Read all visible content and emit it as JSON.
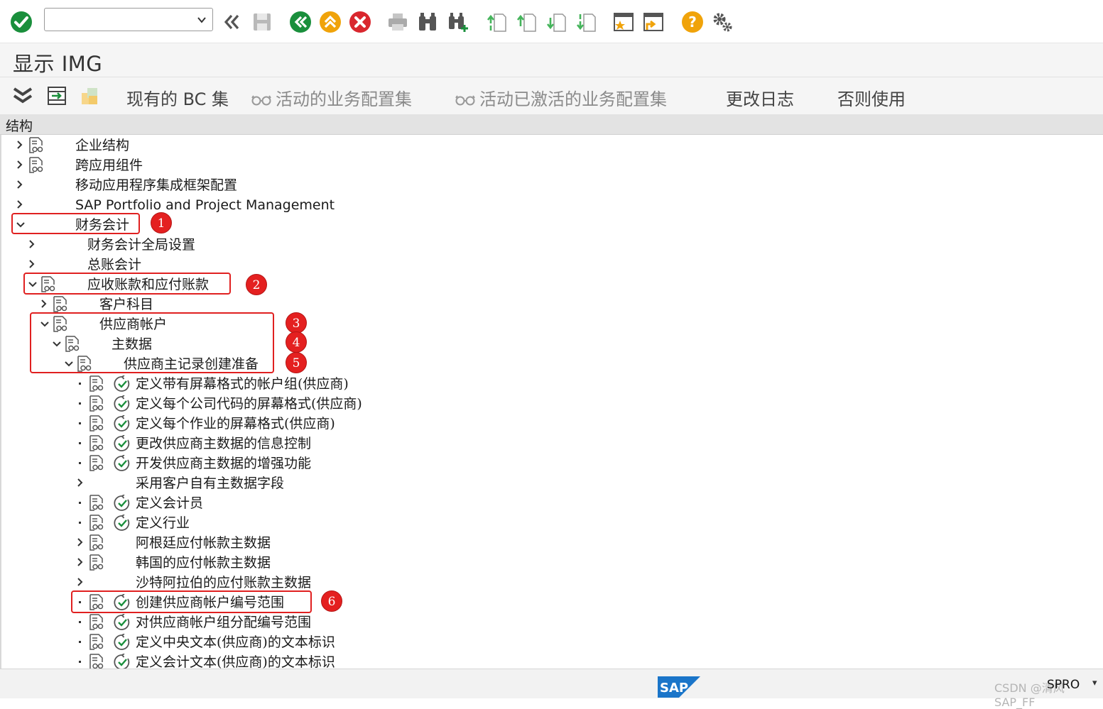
{
  "toolbar": {
    "command_value": "",
    "command_placeholder": ""
  },
  "title": "显示 IMG",
  "app_toolbar": {
    "bc_sets": "现有的 BC 集",
    "active_bc_sets": "活动的业务配置集",
    "activated_bc_sets": "活动已激活的业务配置集",
    "change_log": "更改日志",
    "where_used": "否则使用"
  },
  "tree_header": "结构",
  "tree": [
    {
      "label": "企业结构"
    },
    {
      "label": "跨应用组件"
    },
    {
      "label": "移动应用程序集成框架配置"
    },
    {
      "label": "SAP Portfolio and Project Management"
    },
    {
      "label": "财务会计"
    },
    {
      "label": "财务会计全局设置"
    },
    {
      "label": "总账会计"
    },
    {
      "label": "应收账款和应付账款"
    },
    {
      "label": "客户科目"
    },
    {
      "label": "供应商帐户"
    },
    {
      "label": "主数据"
    },
    {
      "label": "供应商主记录创建准备"
    },
    {
      "label": "定义带有屏幕格式的帐户组(供应商)"
    },
    {
      "label": "定义每个公司代码的屏幕格式(供应商)"
    },
    {
      "label": "定义每个作业的屏幕格式(供应商)"
    },
    {
      "label": "更改供应商主数据的信息控制"
    },
    {
      "label": "开发供应商主数据的增强功能"
    },
    {
      "label": "采用客户自有主数据字段"
    },
    {
      "label": "定义会计员"
    },
    {
      "label": "定义行业"
    },
    {
      "label": "阿根廷应付帐款主数据"
    },
    {
      "label": "韩国的应付帐款主数据"
    },
    {
      "label": "沙特阿拉伯的应付账款主数据"
    },
    {
      "label": "创建供应商帐户编号范围"
    },
    {
      "label": "对供应商帐户组分配编号范围"
    },
    {
      "label": "定义中央文本(供应商)的文本标识"
    },
    {
      "label": "定义会计文本(供应商)的文本标识"
    }
  ],
  "annotations": [
    "1",
    "2",
    "3",
    "4",
    "5",
    "6"
  ],
  "status": {
    "logo": "SAP",
    "watermark": "CSDN @清风SAP_FF",
    "tcode": "SPRO"
  },
  "colors": {
    "accent_green": "#1a8f3c",
    "accent_orange": "#f0a30a",
    "accent_red": "#d9272e",
    "annotation_red": "#e02020",
    "sap_blue": "#1a75c9"
  }
}
